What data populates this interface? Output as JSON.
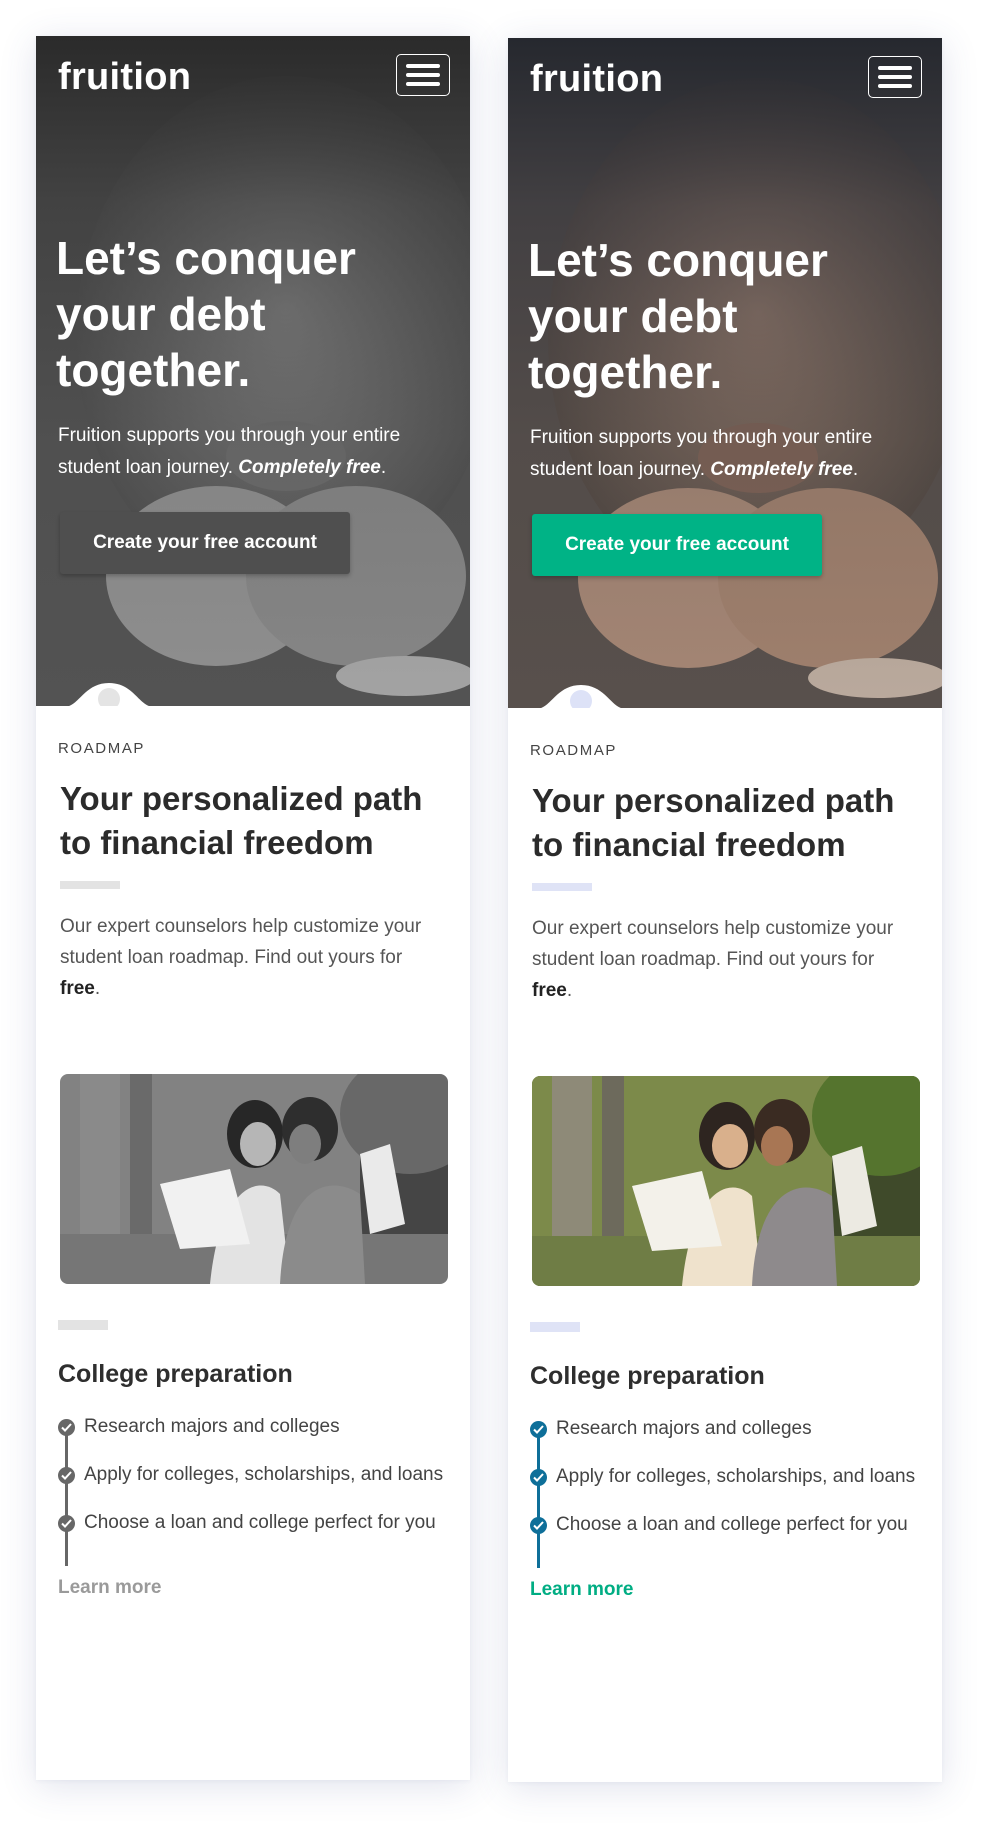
{
  "screens": [
    {
      "variant": "grayscale",
      "brand": "fruition",
      "hero": {
        "title": "Let’s conquer your debt together.",
        "subtitle_plain": "Fruition supports you through your entire student loan journey. ",
        "subtitle_emphasis": "Completely free",
        "subtitle_end": ".",
        "cta_label": "Create your free account"
      },
      "roadmap": {
        "eyebrow": "ROADMAP",
        "title": "Your personalized path to financial freedom",
        "text_plain": "Our expert counselors help customize your student loan roadmap. Find out yours for ",
        "text_bold": "free",
        "text_end": "."
      },
      "college": {
        "title": "College preparation",
        "steps": [
          "Research majors and colleges",
          "Apply for colleges, scholarships, and loans",
          "Choose a loan and college perfect for you"
        ],
        "learn_more": "Learn more"
      }
    },
    {
      "variant": "color",
      "brand": "fruition",
      "hero": {
        "title": "Let’s conquer your debt together.",
        "subtitle_plain": "Fruition supports you through your entire student loan journey. ",
        "subtitle_emphasis": "Completely free",
        "subtitle_end": ".",
        "cta_label": "Create your free account"
      },
      "roadmap": {
        "eyebrow": "ROADMAP",
        "title": "Your personalized path to financial freedom",
        "text_plain": "Our expert counselors help customize your student loan roadmap. Find out yours for ",
        "text_bold": "free",
        "text_end": "."
      },
      "college": {
        "title": "College preparation",
        "steps": [
          "Research majors and colleges",
          "Apply for colleges, scholarships, and loans",
          "Choose a loan and college perfect for you"
        ],
        "learn_more": "Learn more"
      }
    }
  ],
  "colors": {
    "cta_color_variant": "#00b386",
    "accent_blue": "#0e6f99",
    "link_green": "#00ad83",
    "gray_variant": "#4f4f4f"
  },
  "icons": [
    "hamburger-menu-icon",
    "check-circle-icon"
  ]
}
